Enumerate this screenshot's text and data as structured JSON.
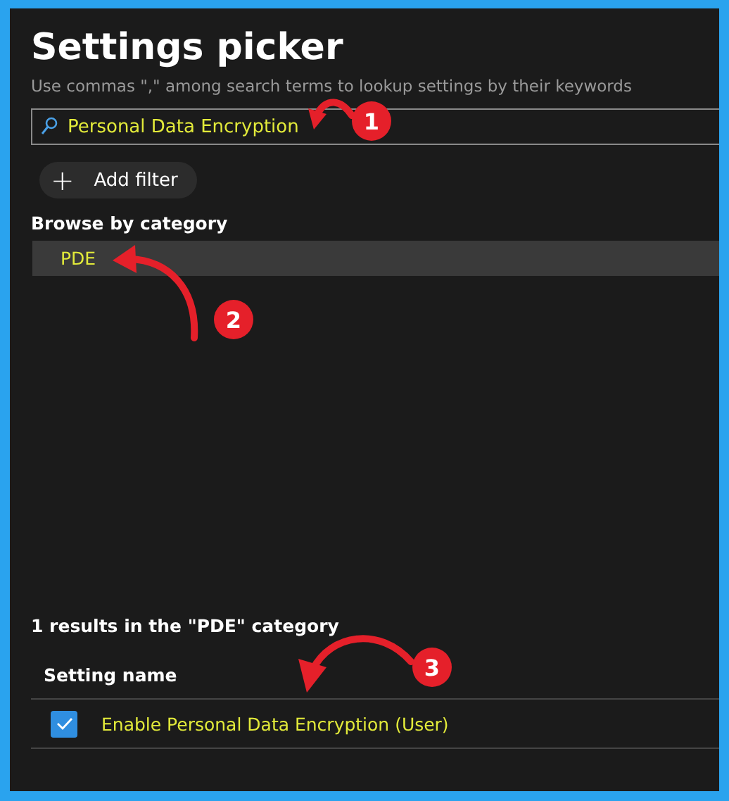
{
  "title": "Settings picker",
  "subtitle": "Use commas \",\" among search terms to lookup settings by their keywords",
  "search": {
    "value": "Personal Data Encryption"
  },
  "add_filter": {
    "icon": "+",
    "label": "Add filter"
  },
  "browse": {
    "heading": "Browse by category",
    "categories": [
      {
        "label": "PDE",
        "selected": true
      }
    ]
  },
  "results": {
    "summary": "1 results in the \"PDE\" category",
    "columns": [
      "Setting name"
    ],
    "rows": [
      {
        "name": "Enable Personal Data Encryption (User)",
        "checked": true
      }
    ]
  },
  "annotations": [
    {
      "number": "1"
    },
    {
      "number": "2"
    },
    {
      "number": "3"
    }
  ]
}
